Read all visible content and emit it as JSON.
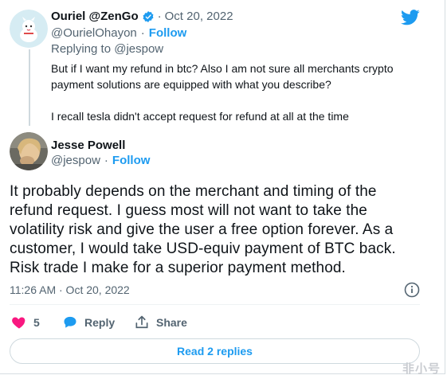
{
  "quoted": {
    "display_name": "Ouriel @ZenGo",
    "verified_icon": "verified-badge-icon",
    "timestamp": "Oct 20, 2022",
    "handle": "@OurielOhayon",
    "follow_label": "Follow",
    "replying_to": "Replying to @jespow",
    "text_1": "But if I want my refund in btc? Also I am not sure all merchants crypto",
    "text_2": "payment solutions are equipped with what you describe?",
    "text_3": "I recall tesla didn't accept request for refund at all at the time"
  },
  "main": {
    "display_name": "Jesse Powell",
    "handle": "@jespow",
    "follow_label": "Follow",
    "text_lines": [
      "It probably depends on the merchant and timing of the",
      "refund request. I guess most will not want to take the",
      "volatility risk and give the user a free option forever. As a",
      "customer, I would take USD-equiv payment of BTC back.",
      "Risk trade I make for a superior payment method."
    ],
    "time": "11:26 AM · Oct 20, 2022"
  },
  "actions": {
    "like_count": "5",
    "reply_label": "Reply",
    "share_label": "Share"
  },
  "replies_button": "Read 2 replies",
  "watermark": "非小号",
  "colors": {
    "accent": "#1d9bf0",
    "like": "#f91880",
    "muted": "#536471"
  },
  "icons": [
    "twitter-bird-icon",
    "info-icon",
    "heart-icon",
    "reply-bubble-icon",
    "share-icon"
  ]
}
